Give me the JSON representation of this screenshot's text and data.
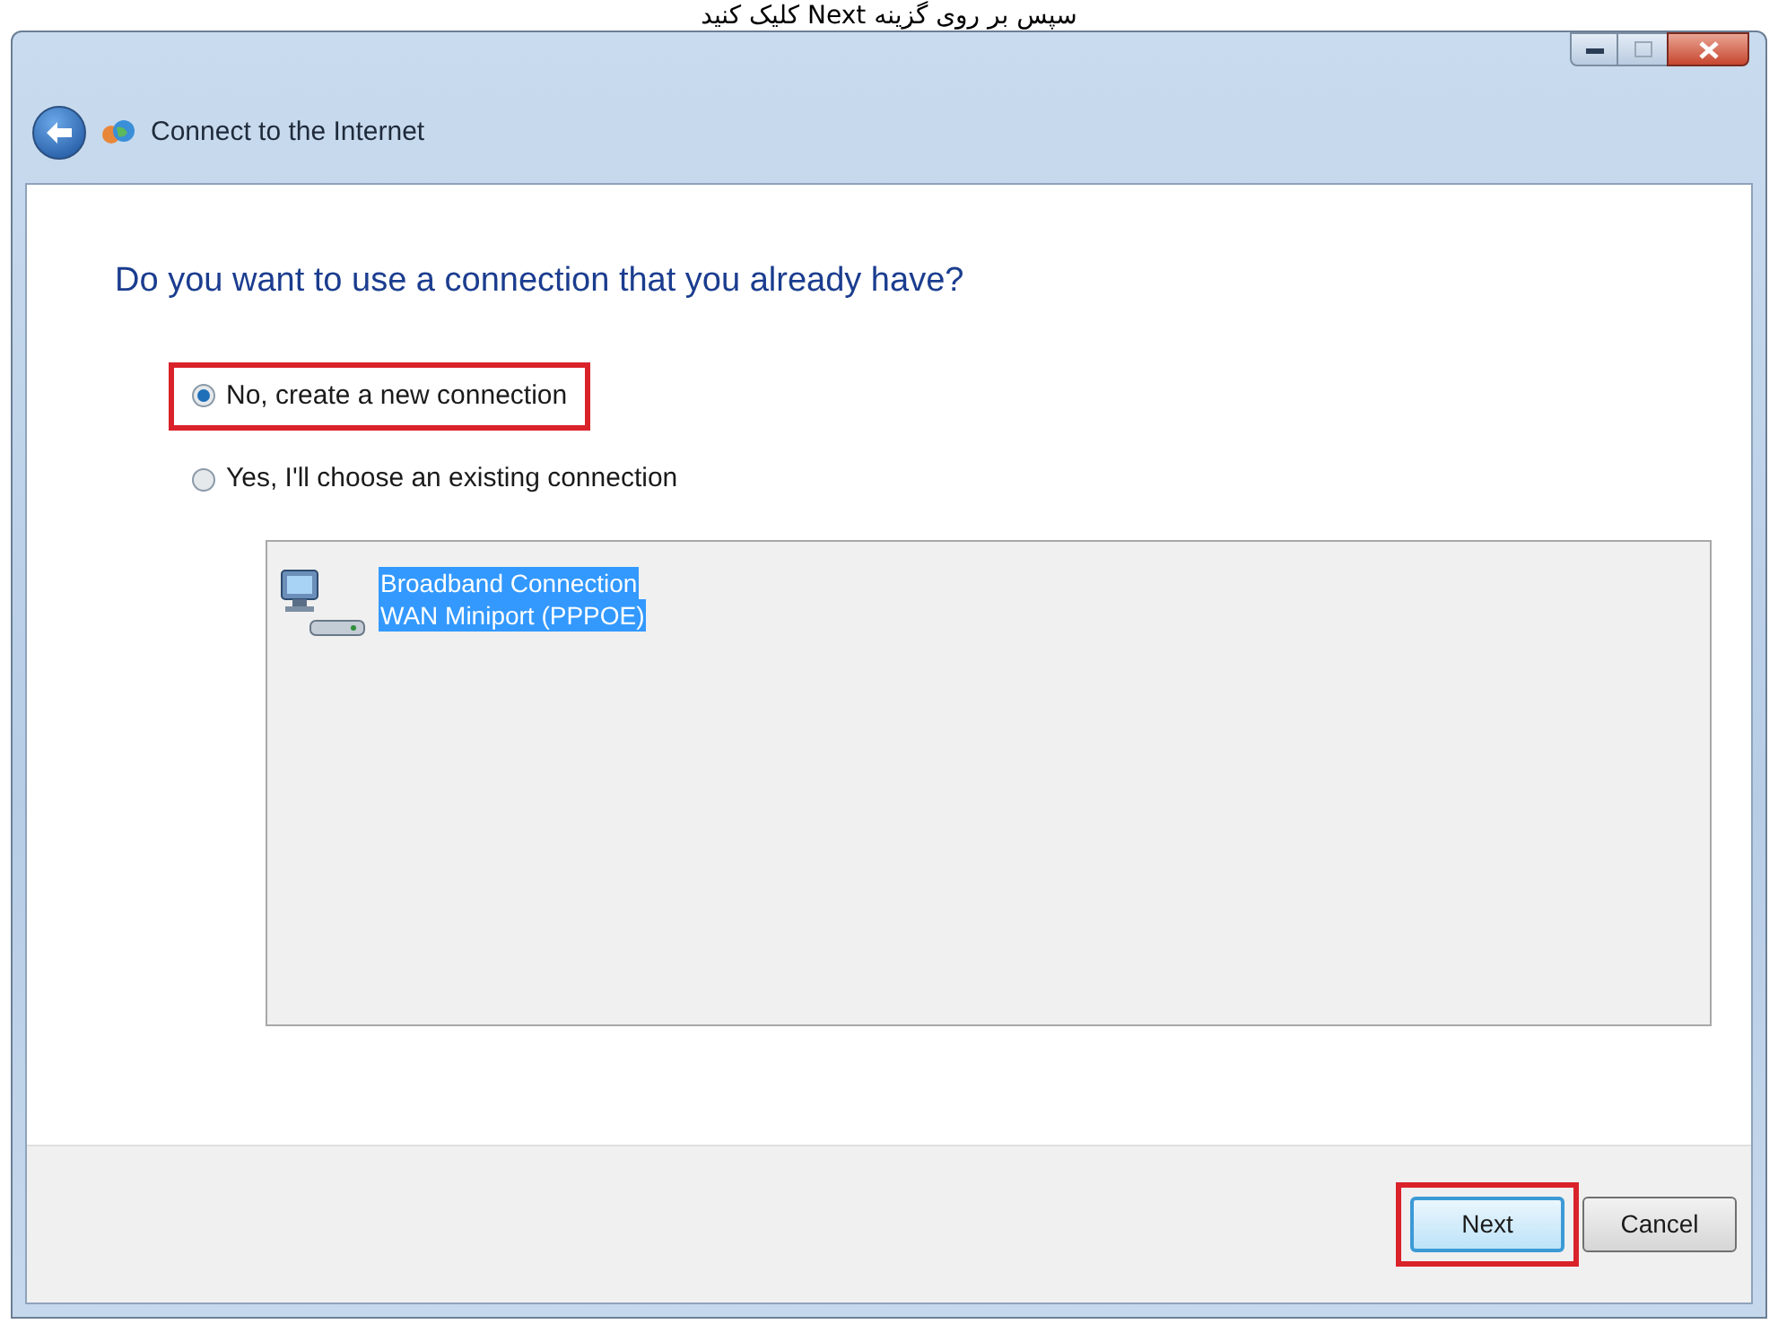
{
  "caption": "سپس بر روی گزینه Next کلیک کنید",
  "window": {
    "title": "Connect to the Internet"
  },
  "heading": "Do you want to use a connection that you already have?",
  "options": [
    {
      "label": "No, create a new connection",
      "selected": true,
      "highlighted": true
    },
    {
      "label": "Yes, I'll choose an existing connection",
      "selected": false,
      "highlighted": false
    }
  ],
  "connections": [
    {
      "name": "Broadband Connection",
      "device": "WAN Miniport (PPPOE)",
      "selected": true
    }
  ],
  "buttons": [
    {
      "label": "Next",
      "default": true,
      "highlighted": true
    },
    {
      "label": "Cancel",
      "default": false,
      "highlighted": false
    }
  ]
}
